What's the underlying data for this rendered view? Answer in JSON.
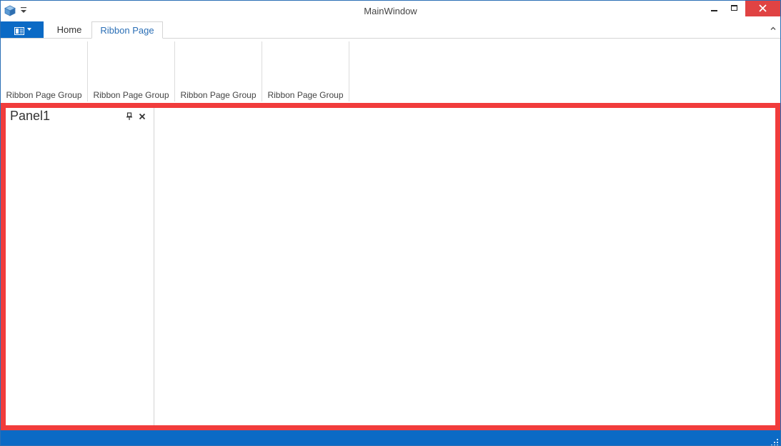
{
  "window": {
    "title": "MainWindow"
  },
  "quick_access": {
    "app_icon": "cube-icon",
    "dropdown_icon": "customize-qat-icon"
  },
  "ribbon": {
    "app_menu_icon": "application-menu-icon",
    "tabs": [
      {
        "label": "Home",
        "selected": false
      },
      {
        "label": "Ribbon Page",
        "selected": true
      }
    ],
    "groups": [
      {
        "label": "Ribbon Page Group"
      },
      {
        "label": "Ribbon Page Group"
      },
      {
        "label": "Ribbon Page Group"
      },
      {
        "label": "Ribbon Page Group"
      }
    ]
  },
  "dock": {
    "panel": {
      "caption": "Panel1",
      "pin_icon": "pin-icon",
      "close_icon": "close-icon"
    }
  },
  "colors": {
    "accent": "#0b6ac5",
    "close_button": "#e04343",
    "highlight_border": "#f13c3c",
    "selected_tab_text": "#2b6fb6"
  }
}
